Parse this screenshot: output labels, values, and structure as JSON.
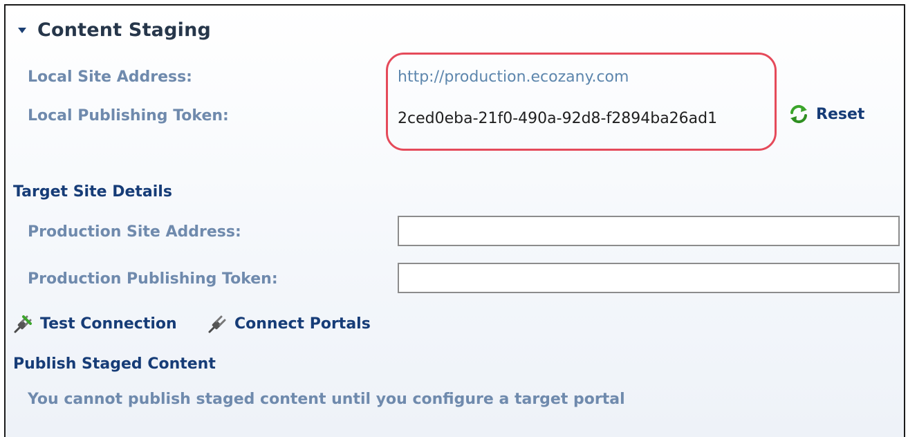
{
  "panel": {
    "title": "Content Staging",
    "collapse_icon": "caret-down-icon"
  },
  "local": {
    "site_address_label": "Local Site Address:",
    "site_address_value": "http://production.ecozany.com",
    "token_label": "Local Publishing Token:",
    "token_value": "2ced0eba-21f0-490a-92d8-f2894ba26ad1",
    "reset_label": "Reset",
    "reset_icon": "refresh-icon",
    "highlight_color": "#e54a5a"
  },
  "target": {
    "section_title": "Target Site Details",
    "production_address_label": "Production Site Address:",
    "production_address_value": "",
    "production_token_label": "Production Publishing Token:",
    "production_token_value": ""
  },
  "actions": {
    "test_connection_label": "Test Connection",
    "connect_portals_label": "Connect Portals",
    "icon": "plug-icon"
  },
  "publish": {
    "section_title": "Publish Staged Content",
    "message": "You cannot publish staged content until you configure a target portal"
  },
  "colors": {
    "heading": "#163c77",
    "label": "#6f8aad",
    "link": "#5d86ad"
  }
}
